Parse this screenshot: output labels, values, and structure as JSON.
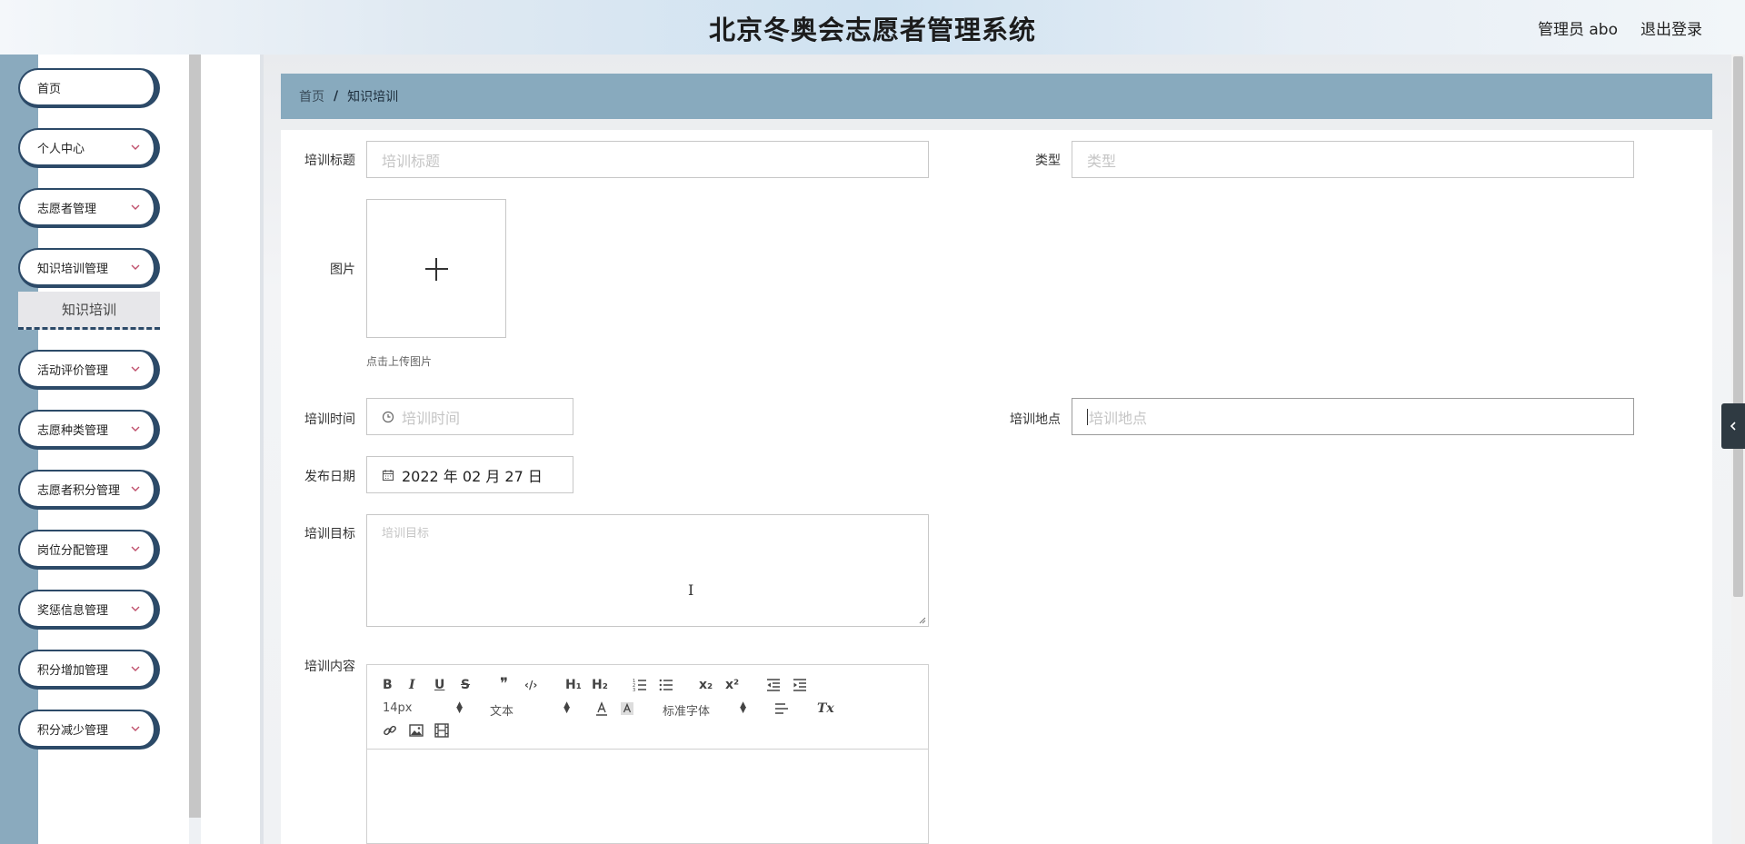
{
  "header": {
    "title": "北京冬奥会志愿者管理系统",
    "user_label": "管理员 abo",
    "logout_label": "退出登录"
  },
  "sidebar": {
    "items": [
      {
        "label": "首页"
      },
      {
        "label": "个人中心"
      },
      {
        "label": "志愿者管理"
      },
      {
        "label": "知识培训管理"
      },
      {
        "label": "活动评价管理"
      },
      {
        "label": "志愿种类管理"
      },
      {
        "label": "志愿者积分管理"
      },
      {
        "label": "岗位分配管理"
      },
      {
        "label": "奖惩信息管理"
      },
      {
        "label": "积分增加管理"
      },
      {
        "label": "积分减少管理"
      }
    ],
    "submenu_active": "知识培训"
  },
  "breadcrumb": {
    "home": "首页",
    "separator": "/",
    "current": "知识培训"
  },
  "form": {
    "title_label": "培训标题",
    "title_placeholder": "培训标题",
    "type_label": "类型",
    "type_placeholder": "类型",
    "image_label": "图片",
    "upload_hint": "点击上传图片",
    "time_label": "培训时间",
    "time_placeholder": "培训时间",
    "location_label": "培训地点",
    "location_placeholder": "培训地点",
    "publish_label": "发布日期",
    "publish_value": "2022 年 02 月 27 日",
    "goal_label": "培训目标",
    "goal_placeholder": "培训目标",
    "content_label": "培训内容"
  },
  "editor": {
    "bold": "B",
    "italic": "I",
    "underline": "U",
    "strike": "S",
    "quote": "❞",
    "code": "‹/›",
    "h1": "H₁",
    "h2": "H₂",
    "sub": "x₂",
    "sup": "x²",
    "font_size": "14px",
    "block_type": "文本",
    "font_family": "标准字体",
    "clean": "Tx"
  },
  "colors": {
    "accent": "#88aabe",
    "nav_border": "#2c4a68",
    "sidebar_strip": "#8aaabe"
  }
}
